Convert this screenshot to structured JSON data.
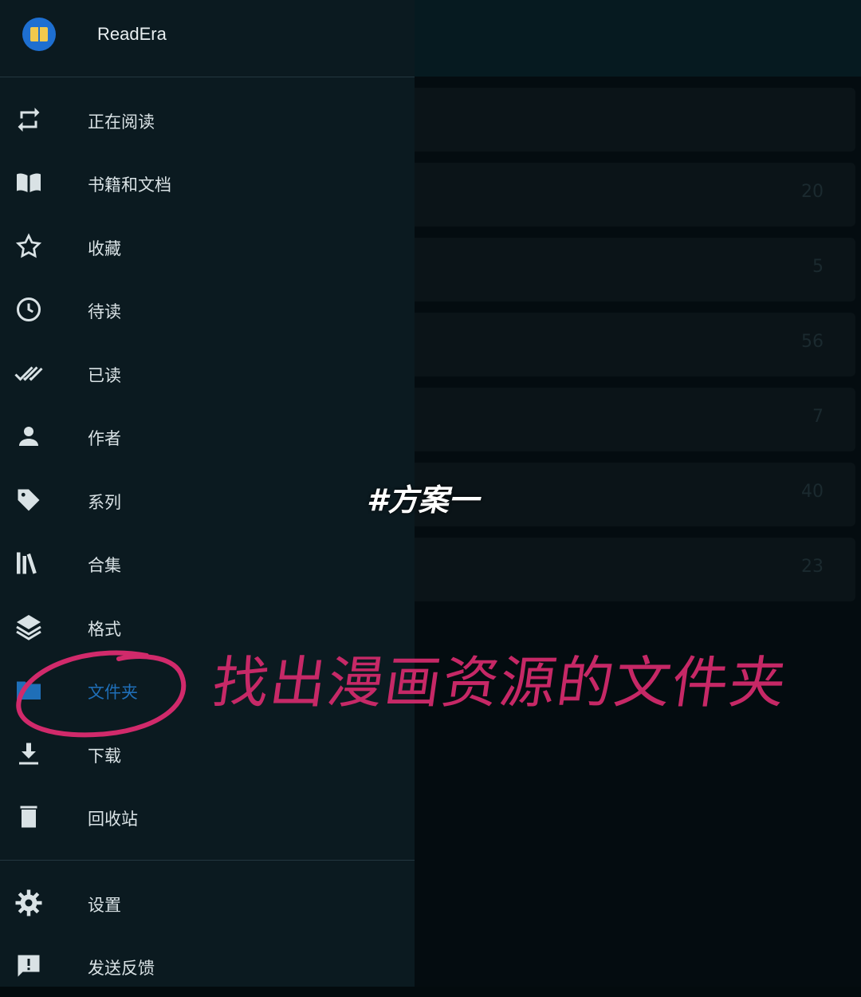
{
  "app": {
    "title": "ReadEra"
  },
  "background": {
    "counts": [
      "20",
      "5",
      "56",
      "7",
      "40",
      "23"
    ]
  },
  "drawer": {
    "items": [
      {
        "label": "正在阅读",
        "icon": "repeat-icon"
      },
      {
        "label": "书籍和文档",
        "icon": "open-book-icon"
      },
      {
        "label": "收藏",
        "icon": "star-icon"
      },
      {
        "label": "待读",
        "icon": "clock-icon"
      },
      {
        "label": "已读",
        "icon": "double-check-icon"
      },
      {
        "label": "作者",
        "icon": "person-icon"
      },
      {
        "label": "系列",
        "icon": "tag-icon"
      },
      {
        "label": "合集",
        "icon": "library-icon"
      },
      {
        "label": "格式",
        "icon": "layers-icon"
      },
      {
        "label": "文件夹",
        "icon": "folder-icon",
        "active": true
      },
      {
        "label": "下载",
        "icon": "download-icon"
      },
      {
        "label": "回收站",
        "icon": "trash-icon"
      }
    ],
    "footer_items": [
      {
        "label": "设置",
        "icon": "gear-icon"
      },
      {
        "label": "发送反馈",
        "icon": "feedback-icon"
      }
    ]
  },
  "overlay": {
    "tag": "#方案一",
    "handwriting": "找出漫画资源的文件夹"
  },
  "colors": {
    "drawer_bg": "#0b1a20",
    "active_label": "#1f6fb8",
    "annotation": "#d12a6b"
  }
}
